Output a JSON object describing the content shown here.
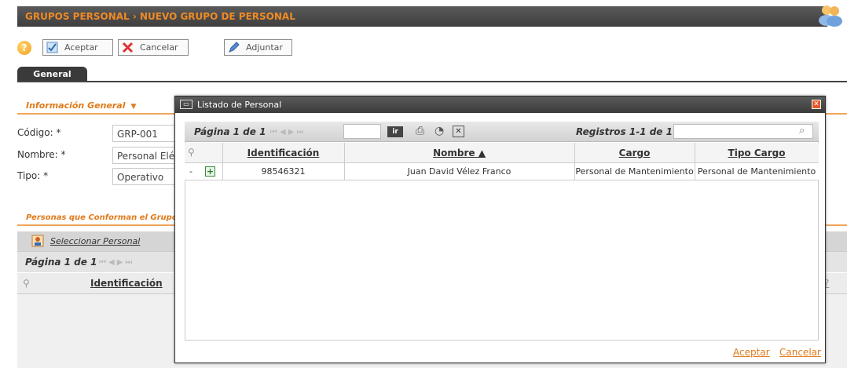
{
  "header": {
    "title": "GRUPOS PERSONAL › NUEVO GRUPO DE PERSONAL"
  },
  "toolbar": {
    "accept_label": "Aceptar",
    "cancel_label": "Cancelar",
    "attach_label": "Adjuntar",
    "help_symbol": "?"
  },
  "tabs": [
    {
      "label": "General"
    }
  ],
  "general_info": {
    "heading": "Información General",
    "fields": [
      {
        "label": "Código: *",
        "value": "GRP-001"
      },
      {
        "label": "Nombre: *",
        "value": "Personal Eléc"
      },
      {
        "label": "Tipo: *",
        "value": "Operativo"
      }
    ]
  },
  "members": {
    "heading": "Personas que Conforman el Grupo",
    "select_label": "Seleccionar Personal",
    "page_text": "Página 1 de 1",
    "col_identification": "Identificación"
  },
  "modal": {
    "title": "Listado de Personal",
    "page_text": "Página 1 de 1",
    "go_label": "ir",
    "records_text": "Registros 1-1 de 1",
    "columns": [
      "Identificación",
      "Nombre ▲",
      "Cargo",
      "Tipo Cargo"
    ],
    "rows": [
      {
        "dash": "-",
        "identification": "98546321",
        "name": "Juan David Vélez Franco",
        "cargo": "Personal de Mantenimiento",
        "tipo_cargo": "Personal de Mantenimiento"
      }
    ],
    "accept_label": "Aceptar",
    "cancel_label": "Cancelar"
  }
}
